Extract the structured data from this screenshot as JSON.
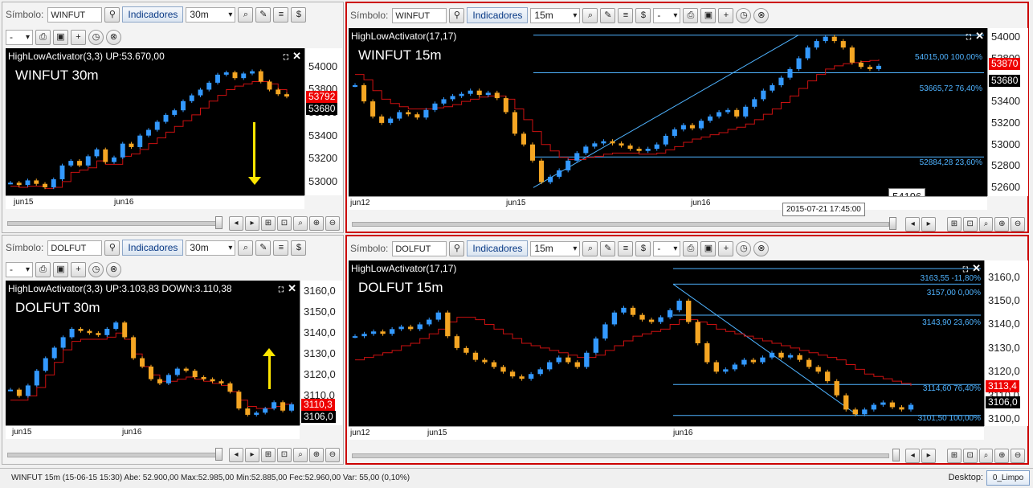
{
  "toolbar": {
    "symbol_label": "Símbolo:",
    "indicators_label": "Indicadores",
    "small_select": "-"
  },
  "panels": {
    "p1": {
      "symbol": "WINFUT",
      "timeframe": "30m",
      "title": "HighLowActivator(3,3) UP:53.670,00",
      "chart_symbol": "WINFUT 30m",
      "x_labels": [
        "jun15",
        "jun16"
      ],
      "y_ticks": [
        "54000",
        "53800",
        "53600",
        "53400",
        "53200",
        "53000"
      ],
      "price_tags": [
        "53792",
        "53680"
      ]
    },
    "p2": {
      "symbol": "WINFUT",
      "timeframe": "15m",
      "title": "HighLowActivator(17,17)",
      "chart_symbol": "WINFUT 15m",
      "x_labels": [
        "jun12",
        "jun15",
        "jun16"
      ],
      "y_ticks": [
        "54000",
        "53800",
        "53600",
        "53400",
        "53200",
        "53000",
        "52800",
        "52600"
      ],
      "price_tags": [
        "53870",
        "53680"
      ],
      "fib_labels": [
        "54015,00 100,00%",
        "53665,72 76,40%",
        "52884,28 23,60%"
      ],
      "hover_value": "54196",
      "tooltip": "2015-07-21 17:45:00"
    },
    "p3": {
      "symbol": "DOLFUT",
      "timeframe": "30m",
      "title": "HighLowActivator(3,3) UP:3.103,83 DOWN:3.110,38",
      "chart_symbol": "DOLFUT 30m",
      "x_labels": [
        "jun15",
        "jun16"
      ],
      "y_ticks": [
        "3160,0",
        "3150,0",
        "3140,0",
        "3130,0",
        "3120,0",
        "3110,0",
        "3100,0"
      ],
      "price_tags": [
        "3110,3",
        "3106,0"
      ]
    },
    "p4": {
      "symbol": "DOLFUT",
      "timeframe": "15m",
      "title": "HighLowActivator(17,17)",
      "chart_symbol": "DOLFUT 15m",
      "x_labels": [
        "jun12",
        "jun15",
        "jun16"
      ],
      "y_ticks": [
        "3160,0",
        "3150,0",
        "3140,0",
        "3130,0",
        "3120,0",
        "3110,0",
        "3100,0"
      ],
      "price_tags": [
        "3113,4",
        "3106,0"
      ],
      "fib_labels": [
        "3163,55 -11,80%",
        "3157,00 0,00%",
        "3143,90 23,60%",
        "3114,60 76,40%",
        "3101,50 100,00%"
      ]
    }
  },
  "status_bar": {
    "text": "WINFUT 15m  (15-06-15 15:30)  Abe: 52.900,00  Max:52.985,00  Min:52.885,00  Fec:52.960,00  Var: 55,00 (0,10%)",
    "desktop_label": "Desktop:",
    "desktop_value": "0_Limpo"
  },
  "colors": {
    "up": "#3399ff",
    "down": "#f5a623",
    "activator": "#cc1111",
    "fib": "#4fb3ff",
    "arrow": "#ffe600"
  },
  "chart_data": [
    {
      "id": "p1",
      "type": "candlestick",
      "series_name": "WINFUT 30m",
      "ylim": [
        52880,
        54160
      ],
      "closes": [
        52990,
        52970,
        53010,
        52980,
        52950,
        53020,
        53140,
        53180,
        53140,
        53220,
        53280,
        53170,
        53210,
        53330,
        53300,
        53400,
        53450,
        53520,
        53580,
        53620,
        53700,
        53750,
        53800,
        53860,
        53930,
        53950,
        53900,
        53940,
        53960,
        53870,
        53800,
        53760,
        53740
      ],
      "activator": [
        52960,
        52950,
        52960,
        52960,
        52940,
        52950,
        53000,
        53080,
        53100,
        53120,
        53180,
        53150,
        53150,
        53220,
        53240,
        53280,
        53330,
        53380,
        53430,
        53480,
        53530,
        53580,
        53640,
        53700,
        53750,
        53800,
        53830,
        53850,
        53870,
        53870,
        53850,
        53800,
        53760
      ]
    },
    {
      "id": "p2",
      "type": "candlestick",
      "series_name": "WINFUT 15m",
      "ylim": [
        52520,
        54080
      ],
      "closes": [
        53550,
        53400,
        53260,
        53200,
        53240,
        53300,
        53280,
        53250,
        53320,
        53380,
        53420,
        53450,
        53470,
        53500,
        53460,
        53480,
        53430,
        53300,
        53100,
        53000,
        52850,
        52650,
        52700,
        52760,
        52850,
        52920,
        52980,
        53010,
        53030,
        53010,
        52990,
        52960,
        52940,
        52960,
        53000,
        53080,
        53140,
        53180,
        53150,
        53220,
        53260,
        53300,
        53320,
        53260,
        53350,
        53420,
        53500,
        53550,
        53620,
        53700,
        53800,
        53900,
        53960,
        54000,
        53960,
        53900,
        53760,
        53720,
        53700,
        53730
      ],
      "activator": [
        53650,
        53600,
        53500,
        53420,
        53380,
        53350,
        53330,
        53330,
        53330,
        53340,
        53350,
        53370,
        53400,
        53420,
        53440,
        53450,
        53450,
        53420,
        53330,
        53230,
        53120,
        53000,
        52940,
        52880,
        52860,
        52860,
        52880,
        52890,
        52910,
        52920,
        52920,
        52920,
        52910,
        52910,
        52920,
        52950,
        52980,
        53020,
        53050,
        53070,
        53090,
        53110,
        53140,
        53160,
        53190,
        53230,
        53280,
        53330,
        53390,
        53450,
        53520,
        53590,
        53650,
        53700,
        53730,
        53750,
        53760,
        53770,
        53780,
        53790
      ],
      "fib_levels": [
        54015,
        53665.72,
        52884.28
      ]
    },
    {
      "id": "p3",
      "type": "candlestick",
      "series_name": "DOLFUT 30m",
      "ylim": [
        3096,
        3165
      ],
      "closes": [
        3113,
        3110,
        3115,
        3122,
        3128,
        3133,
        3138,
        3142,
        3141,
        3140,
        3139,
        3142,
        3145,
        3138,
        3128,
        3124,
        3118,
        3116,
        3120,
        3123,
        3122,
        3119,
        3118,
        3117,
        3116,
        3112,
        3104,
        3101,
        3102,
        3104,
        3107,
        3103,
        3106
      ],
      "activator": [
        3108,
        3108,
        3110,
        3114,
        3120,
        3126,
        3132,
        3136,
        3137,
        3137,
        3137,
        3138,
        3140,
        3137,
        3130,
        3124,
        3120,
        3117,
        3117,
        3118,
        3119,
        3118,
        3117,
        3116,
        3115,
        3112,
        3108,
        3105,
        3104,
        3104,
        3105,
        3106,
        3107
      ]
    },
    {
      "id": "p4",
      "type": "candlestick",
      "series_name": "DOLFUT 15m",
      "ylim": [
        3097,
        3167
      ],
      "closes": [
        3135,
        3136,
        3137,
        3136,
        3138,
        3139,
        3138,
        3140,
        3142,
        3145,
        3135,
        3130,
        3128,
        3125,
        3124,
        3122,
        3120,
        3118,
        3117,
        3119,
        3121,
        3124,
        3126,
        3124,
        3122,
        3128,
        3134,
        3140,
        3145,
        3147,
        3144,
        3142,
        3141,
        3143,
        3146,
        3150,
        3141,
        3132,
        3124,
        3120,
        3121,
        3123,
        3125,
        3124,
        3126,
        3128,
        3126,
        3127,
        3125,
        3122,
        3120,
        3116,
        3110,
        3104,
        3102,
        3104,
        3106,
        3107,
        3105,
        3104,
        3106
      ],
      "activator": [
        3125,
        3126,
        3127,
        3128,
        3129,
        3131,
        3132,
        3134,
        3136,
        3138,
        3141,
        3143,
        3143,
        3142,
        3140,
        3138,
        3136,
        3134,
        3132,
        3131,
        3130,
        3129,
        3128,
        3127,
        3126,
        3126,
        3127,
        3129,
        3131,
        3133,
        3135,
        3136,
        3137,
        3138,
        3140,
        3142,
        3142,
        3141,
        3140,
        3138,
        3137,
        3136,
        3135,
        3134,
        3133,
        3132,
        3131,
        3130,
        3129,
        3128,
        3127,
        3126,
        3125,
        3123,
        3121,
        3119,
        3118,
        3117,
        3116,
        3115,
        3114
      ],
      "fib_levels": [
        3163.55,
        3157.0,
        3143.9,
        3114.6,
        3101.5
      ]
    }
  ]
}
